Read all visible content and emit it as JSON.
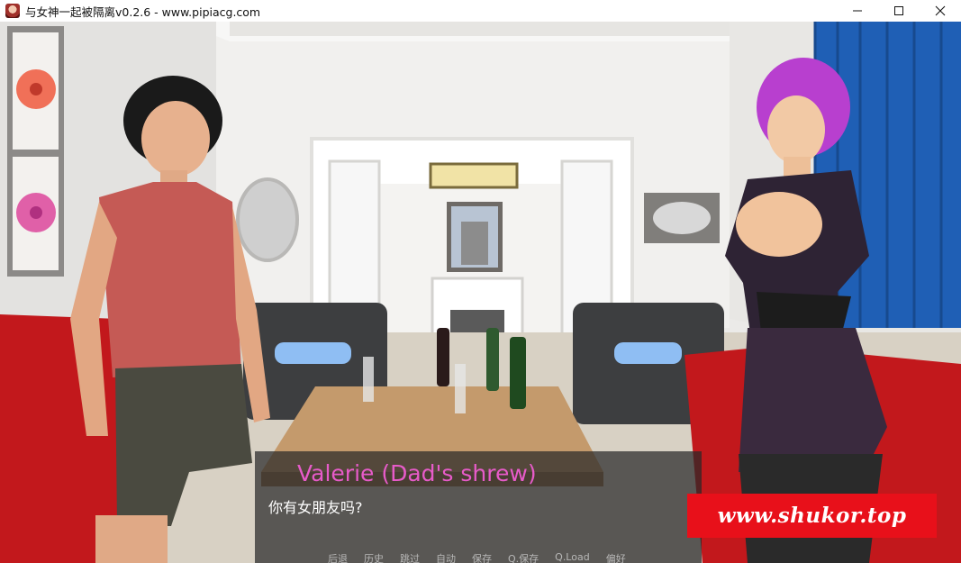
{
  "window": {
    "title": "与女神一起被隔离v0.2.6 - www.pipiacg.com",
    "icon": "game-app-icon",
    "controls": [
      "minimize-icon",
      "maximize-icon",
      "close-icon"
    ]
  },
  "dialogue": {
    "speaker": "Valerie (Dad's shrew)",
    "speaker_color": "#e75bc9",
    "text": "你有女朋友吗?"
  },
  "quick_menu": {
    "back": "后退",
    "history": "历史",
    "skip": "跳过",
    "auto": "自动",
    "save": "保存",
    "qsave": "Q.保存",
    "qload": "Q.Load",
    "prefs": "偏好"
  },
  "watermark": {
    "text": "www.shukor.top",
    "color": "#e8101a"
  }
}
